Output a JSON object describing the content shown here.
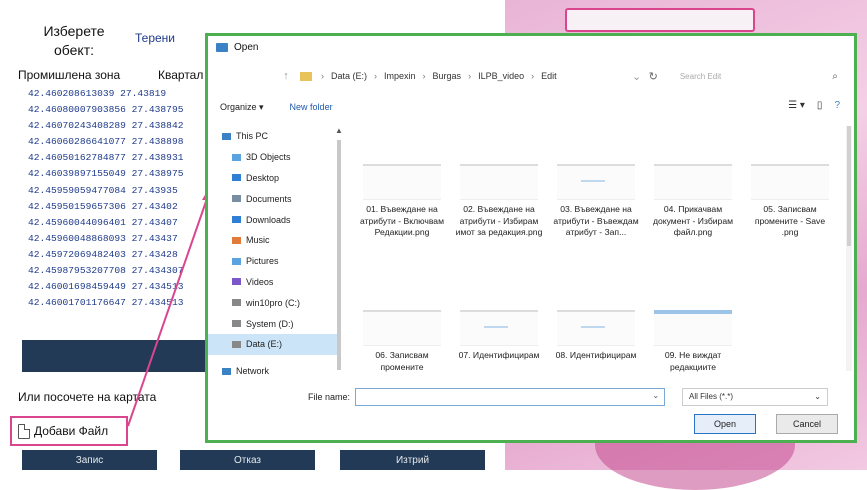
{
  "background_app": {
    "object_label": "Изберете обект:",
    "object_select": "Терени",
    "columns": [
      "Промишлена зона",
      "Квартал"
    ],
    "rows": [
      {
        "lat": "42.460208613039",
        "lon": "27.43819"
      },
      {
        "lat": "42.46080007903856",
        "lon": "27.438795"
      },
      {
        "lat": "42.46070243408289",
        "lon": "27.438842"
      },
      {
        "lat": "42.46060286641077",
        "lon": "27.438898"
      },
      {
        "lat": "42.46050162784877",
        "lon": "27.438931"
      },
      {
        "lat": "42.46039897155049",
        "lon": "27.438975"
      },
      {
        "lat": "42.45959059477084",
        "lon": "27.43935"
      },
      {
        "lat": "42.45950159657306",
        "lon": "27.43402"
      },
      {
        "lat": "42.45960044096401",
        "lon": "27.43407"
      },
      {
        "lat": "42.45960048868093",
        "lon": "27.43437"
      },
      {
        "lat": "42.45972069482403",
        "lon": "27.43428"
      },
      {
        "lat": "42.45987953207708",
        "lon": "27.434307"
      },
      {
        "lat": "42.46001698459449",
        "lon": "27.434513"
      },
      {
        "lat": "42.46001701176647",
        "lon": "27.434513"
      }
    ],
    "map_hint": "Или посочете на картата",
    "add_file_label": "Добави Файл",
    "bottom_buttons": [
      "Запис",
      "Отказ",
      "Изтрий"
    ],
    "highlight_color": "#d9468e"
  },
  "dialog": {
    "title": "Open",
    "border_color": "#4caf50",
    "breadcrumb": [
      "Data (E:)",
      "Impexin",
      "Burgas",
      "ILPB_video",
      "Edit"
    ],
    "search_placeholder": "Search Edit",
    "organize_label": "Organize ▾",
    "new_folder_label": "New folder",
    "nav_items": [
      {
        "label": "This PC",
        "icon": "computer-icon",
        "color": "#3b82c4"
      },
      {
        "label": "3D Objects",
        "icon": "cube-icon",
        "color": "#5ba3e0"
      },
      {
        "label": "Desktop",
        "icon": "desktop-icon",
        "color": "#2f7fd4"
      },
      {
        "label": "Documents",
        "icon": "documents-icon",
        "color": "#7a8ea3"
      },
      {
        "label": "Downloads",
        "icon": "download-icon",
        "color": "#2f7fd4"
      },
      {
        "label": "Music",
        "icon": "music-icon",
        "color": "#e07b39"
      },
      {
        "label": "Pictures",
        "icon": "pictures-icon",
        "color": "#5ba3e0"
      },
      {
        "label": "Videos",
        "icon": "videos-icon",
        "color": "#7b57c9"
      },
      {
        "label": "win10pro (C:)",
        "icon": "drive-icon",
        "color": "#888888"
      },
      {
        "label": "System (D:)",
        "icon": "drive-icon",
        "color": "#888888"
      },
      {
        "label": "Data (E:)",
        "icon": "drive-icon",
        "color": "#888888"
      },
      {
        "label": "Network",
        "icon": "network-icon",
        "color": "#3b82c4"
      }
    ],
    "files": [
      {
        "name": "01. Въвеждане на атрибути - Включвам Редакции.png"
      },
      {
        "name": "02. Въвеждане на атрибути - Избирам имот за редакция.png"
      },
      {
        "name": "03. Въвеждане на атрибути - Въвеждам атрибут - Зап..."
      },
      {
        "name": "04. Прикачвам документ - Избирам файл.png"
      },
      {
        "name": "05. Записвам промените - Save .png"
      },
      {
        "name": "06. Записвам промените"
      },
      {
        "name": "07. Идентифицирам"
      },
      {
        "name": "08. Идентифицирам"
      },
      {
        "name": "09. Не виждат редакциите"
      }
    ],
    "file_name_label": "File name:",
    "file_name_value": "",
    "file_type_filter": "All Files (*.*)",
    "open_button": "Open",
    "cancel_button": "Cancel"
  }
}
